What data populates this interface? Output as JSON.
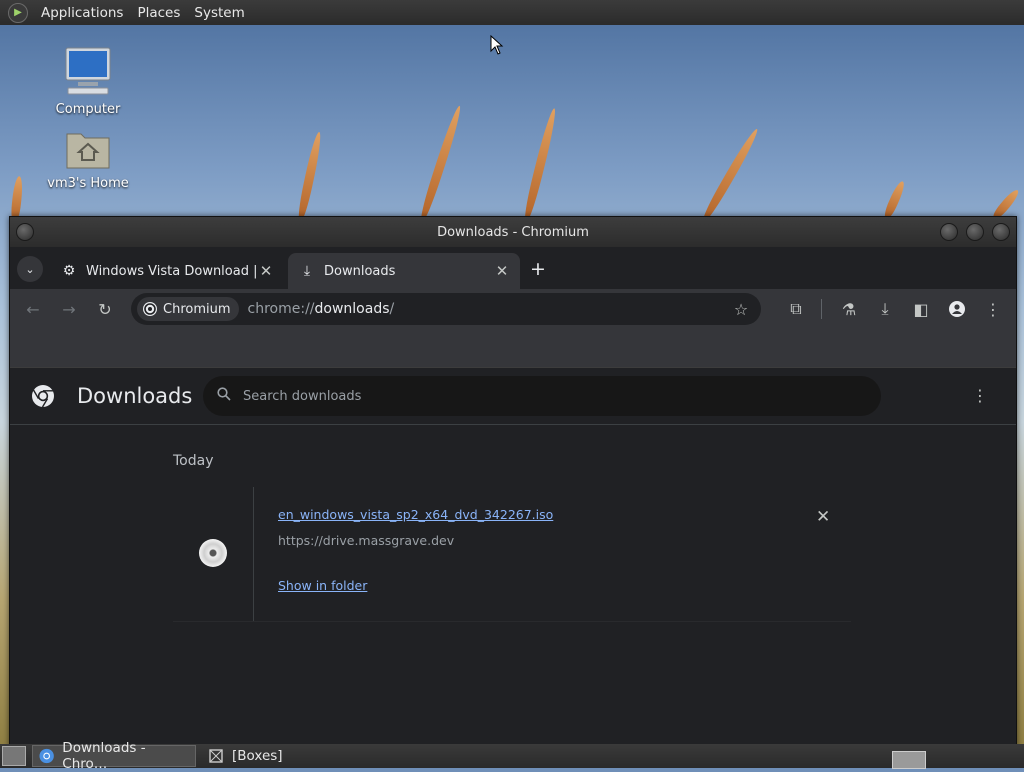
{
  "topbar": {
    "menus": [
      "Applications",
      "Places",
      "System"
    ]
  },
  "desktop": {
    "icons": [
      {
        "label": "Computer"
      },
      {
        "label": "vm3's Home"
      }
    ]
  },
  "window": {
    "title": "Downloads - Chromium",
    "tabs": [
      {
        "title": "Windows Vista Download | M",
        "icon": "gear-icon",
        "active": false
      },
      {
        "title": "Downloads",
        "icon": "download-icon",
        "active": true
      }
    ],
    "omnibox": {
      "chip": "Chromium",
      "url_prefix": "chrome://",
      "url_host": "downloads",
      "url_suffix": "/"
    }
  },
  "downloads": {
    "title": "Downloads",
    "search_placeholder": "Search downloads",
    "date_header": "Today",
    "items": [
      {
        "filename": "en_windows_vista_sp2_x64_dvd_342267.iso",
        "source": "https://drive.massgrave.dev",
        "action": "Show in folder"
      }
    ]
  },
  "taskbar": {
    "tasks": [
      {
        "label": "Downloads - Chro…",
        "active": true
      },
      {
        "label": "[Boxes]",
        "active": false
      }
    ]
  },
  "colors": {
    "accent_link": "#8ab4f8",
    "page_bg": "#202124",
    "toolbar_bg": "#35363a"
  }
}
